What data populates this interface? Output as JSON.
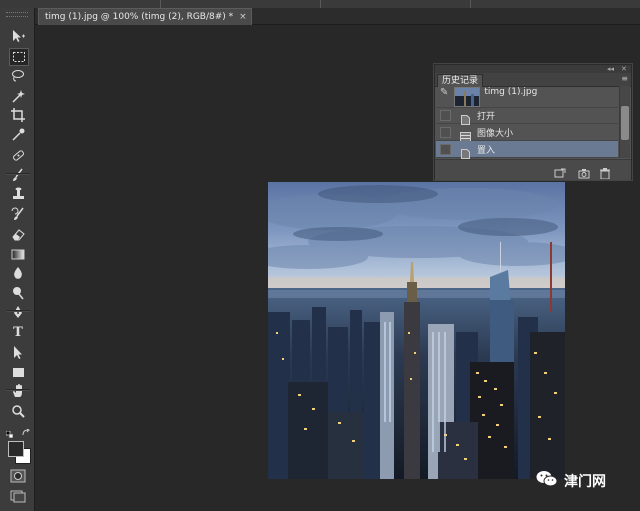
{
  "document": {
    "tab_title": "timg (1).jpg @ 100% (timg (2), RGB/8#) *",
    "close_glyph": "×"
  },
  "tools": [
    {
      "name": "move-tool-icon",
      "icon": "move"
    },
    {
      "name": "rectangular-marquee-tool-icon",
      "icon": "marquee",
      "active": true
    },
    {
      "name": "lasso-tool-icon",
      "icon": "lasso"
    },
    {
      "name": "magic-wand-tool-icon",
      "icon": "wand"
    },
    {
      "name": "crop-tool-icon",
      "icon": "crop"
    },
    {
      "name": "eyedropper-tool-icon",
      "icon": "eyedropper"
    },
    {
      "name": "healing-brush-tool-icon",
      "icon": "healing"
    },
    {
      "name": "brush-tool-icon",
      "icon": "brush"
    },
    {
      "name": "clone-stamp-tool-icon",
      "icon": "stamp"
    },
    {
      "name": "history-brush-tool-icon",
      "icon": "history-brush"
    },
    {
      "name": "eraser-tool-icon",
      "icon": "eraser"
    },
    {
      "name": "gradient-tool-icon",
      "icon": "gradient"
    },
    {
      "name": "blur-tool-icon",
      "icon": "blur"
    },
    {
      "name": "dodge-tool-icon",
      "icon": "dodge"
    },
    {
      "name": "pen-tool-icon",
      "icon": "pen"
    },
    {
      "name": "type-tool-icon",
      "icon": "type",
      "glyph": "T"
    },
    {
      "name": "path-selection-tool-icon",
      "icon": "path-select"
    },
    {
      "name": "rectangle-shape-tool-icon",
      "icon": "rectangle"
    },
    {
      "name": "hand-tool-icon",
      "icon": "hand"
    },
    {
      "name": "zoom-tool-icon",
      "icon": "zoom"
    }
  ],
  "history_panel": {
    "tab_label": "历史记录",
    "collapse_glyph": "◂◂",
    "close_glyph": "✕",
    "menu_glyph": "≡",
    "snapshot": {
      "label": "timg (1).jpg"
    },
    "states": [
      {
        "label": "打开",
        "icon": "document-icon",
        "selected": false
      },
      {
        "label": "图像大小",
        "icon": "image-size-icon",
        "selected": false
      },
      {
        "label": "置入",
        "icon": "document-icon",
        "selected": true
      }
    ],
    "footer_buttons": [
      "new-document-from-state-icon",
      "camera-icon",
      "trash-icon"
    ]
  },
  "watermark": {
    "text": "津门网"
  }
}
